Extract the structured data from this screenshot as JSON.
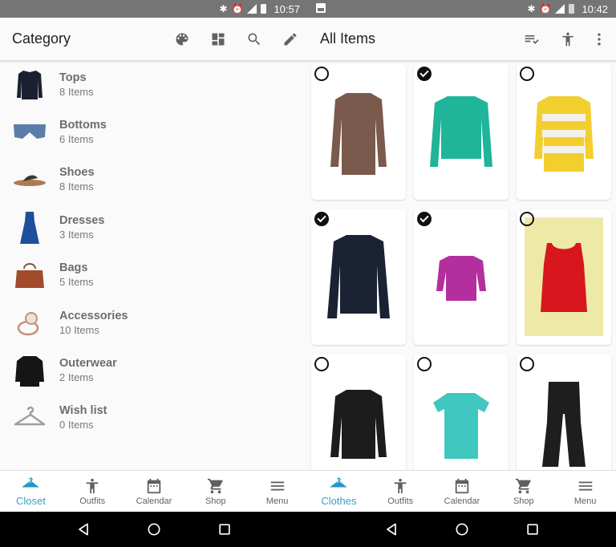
{
  "left_screen": {
    "status_bar": {
      "time": "10:57",
      "icons": [
        "bluetooth-icon",
        "alarm-icon",
        "lte-signal-icon",
        "battery-icon"
      ]
    },
    "app_bar": {
      "title": "Category",
      "actions": [
        "palette-icon",
        "layout-icon",
        "search-icon",
        "edit-icon"
      ]
    },
    "categories": [
      {
        "name": "Tops",
        "count": "8 Items",
        "thumb": "tops"
      },
      {
        "name": "Bottoms",
        "count": "6 Items",
        "thumb": "bottoms"
      },
      {
        "name": "Shoes",
        "count": "8 Items",
        "thumb": "shoes"
      },
      {
        "name": "Dresses",
        "count": "3 Items",
        "thumb": "dresses"
      },
      {
        "name": "Bags",
        "count": "5 Items",
        "thumb": "bags"
      },
      {
        "name": "Accessories",
        "count": "10 Items",
        "thumb": "accessories"
      },
      {
        "name": "Outerwear",
        "count": "2 Items",
        "thumb": "outerwear"
      },
      {
        "name": "Wish list",
        "count": "0 Items",
        "thumb": "hanger"
      }
    ],
    "bottom_nav": [
      {
        "label": "Closet",
        "icon": "hanger-icon",
        "active": true
      },
      {
        "label": "Outfits",
        "icon": "person-icon",
        "active": false
      },
      {
        "label": "Calendar",
        "icon": "calendar-icon",
        "active": false
      },
      {
        "label": "Shop",
        "icon": "cart-icon",
        "active": false
      },
      {
        "label": "Menu",
        "icon": "menu-icon",
        "active": false
      }
    ]
  },
  "right_screen": {
    "status_bar": {
      "time": "10:42",
      "icons": [
        "image-icon",
        "bluetooth-icon",
        "alarm-icon",
        "lte-signal-icon",
        "battery-icon"
      ]
    },
    "app_bar": {
      "title": "All Items",
      "actions": [
        "select-list-icon",
        "person-icon",
        "more-vert-icon"
      ]
    },
    "items": [
      {
        "name": "brown draped top",
        "color": "#7a5a4c",
        "checked": false
      },
      {
        "name": "teal cable-knit sweater",
        "color": "#1fb59a",
        "checked": true
      },
      {
        "name": "yellow striped sweater",
        "color": "#f2cf2e",
        "checked": false
      },
      {
        "name": "navy button shirt",
        "color": "#1b2233",
        "checked": true
      },
      {
        "name": "magenta ruffle blouse",
        "color": "#b42f9e",
        "checked": true
      },
      {
        "name": "red tank top",
        "color": "#d8161d",
        "checked": false
      },
      {
        "name": "black blazer",
        "color": "#1c1c1c",
        "checked": false
      },
      {
        "name": "turquoise graphic tee",
        "color": "#3fc7c0",
        "checked": false
      },
      {
        "name": "black flared pants",
        "color": "#1e1e1e",
        "checked": false
      }
    ],
    "bottom_nav": [
      {
        "label": "Clothes",
        "icon": "hanger-icon",
        "active": true
      },
      {
        "label": "Outfits",
        "icon": "person-icon",
        "active": false
      },
      {
        "label": "Calendar",
        "icon": "calendar-icon",
        "active": false
      },
      {
        "label": "Shop",
        "icon": "cart-icon",
        "active": false
      },
      {
        "label": "Menu",
        "icon": "menu-icon",
        "active": false
      }
    ]
  },
  "colors": {
    "accent": "#2196c9",
    "status_bar": "#757575",
    "icon_gray": "#616161"
  }
}
